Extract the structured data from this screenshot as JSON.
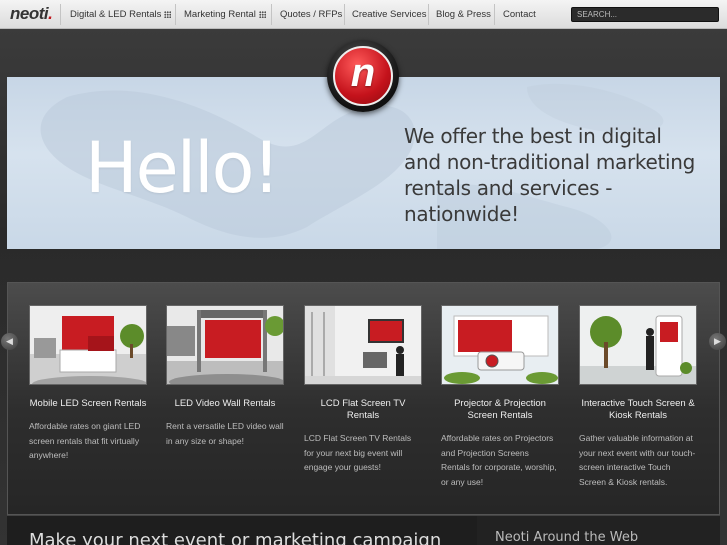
{
  "brand": {
    "logo_text": "neoti",
    "logo_dot": "."
  },
  "nav": {
    "items": [
      {
        "label": "Digital & LED Rentals",
        "has_menu": true
      },
      {
        "label": "Marketing Rental",
        "has_menu": true
      },
      {
        "label": "Quotes / RFPs",
        "has_menu": false
      },
      {
        "label": "Creative Services",
        "has_menu": false
      },
      {
        "label": "Blog & Press",
        "has_menu": false
      },
      {
        "label": "Contact",
        "has_menu": false
      }
    ],
    "search_placeholder": "SEARCH..."
  },
  "hero": {
    "badge_letter": "n",
    "headline": "Hello!",
    "tagline_lines": [
      "We offer the best in digital",
      "and non-traditional marketing",
      "rentals and services - nationwide!"
    ]
  },
  "services": [
    {
      "title": "Mobile LED Screen Rentals",
      "description": "Affordable rates on giant LED screen rentals that fit virtually anywhere!",
      "icon": "mobile-led-truck-image"
    },
    {
      "title": "LED Video Wall Rentals",
      "description": "Rent a versatile LED video wall in any size or shape!",
      "icon": "led-video-wall-image"
    },
    {
      "title": "LCD Flat Screen TV Rentals",
      "description": "LCD Flat Screen TV Rentals for your next big event will engage your guests!",
      "icon": "lcd-flat-screen-image"
    },
    {
      "title": "Projector & Projection Screen Rentals",
      "description": "Affordable rates on Projectors and Projection Screens Rentals for corporate, worship, or any use!",
      "icon": "projector-image"
    },
    {
      "title": "Interactive Touch Screen & Kiosk Rentals",
      "description": "Gather valuable information at your next event with our touch-screen interactive Touch Screen & Kiosk rentals.",
      "icon": "touch-kiosk-image"
    }
  ],
  "bottom": {
    "left_heading": "Make your next event or marketing campaign",
    "right_heading": "Neoti Around the Web"
  },
  "colors": {
    "accent": "#c4121b",
    "nav_bg": "#e8e8e8",
    "page_bg": "#2f2f2f"
  }
}
